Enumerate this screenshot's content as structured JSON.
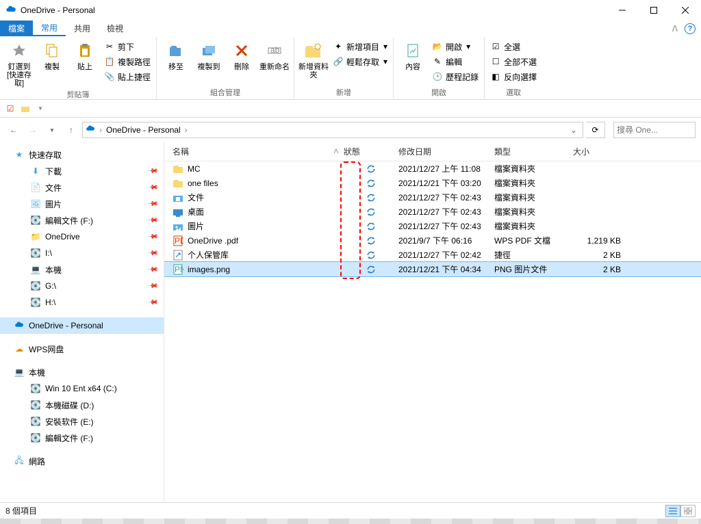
{
  "window": {
    "title": "OneDrive - Personal"
  },
  "tabs": {
    "file": "檔案",
    "home": "常用",
    "share": "共用",
    "view": "檢視"
  },
  "ribbon": {
    "clipboard": {
      "pin_label": "釘選到 [快速存取]",
      "copy": "複製",
      "paste": "貼上",
      "cut": "剪下",
      "copy_path": "複製路徑",
      "paste_shortcut": "貼上捷徑",
      "group": "剪貼簿"
    },
    "organize": {
      "move_to": "移至",
      "copy_to": "複製到",
      "delete": "刪除",
      "rename": "重新命名",
      "group": "組合管理"
    },
    "new": {
      "new_folder": "新增資料夾",
      "new_item": "新增項目",
      "easy_access": "輕鬆存取",
      "group": "新增"
    },
    "open": {
      "properties": "內容",
      "open": "開啟",
      "edit": "編輯",
      "history": "歷程記錄",
      "group": "開啟"
    },
    "select": {
      "select_all": "全選",
      "select_none": "全部不選",
      "invert": "反向選擇",
      "group": "選取"
    }
  },
  "breadcrumb": {
    "location": "OneDrive - Personal"
  },
  "search": {
    "placeholder": "搜尋 One..."
  },
  "columns": {
    "name": "名稱",
    "status": "狀態",
    "modified": "修改日期",
    "type": "類型",
    "size": "大小"
  },
  "rows": [
    {
      "icon": "folder-yellow",
      "name": "MC",
      "date": "2021/12/27 上午 11:08",
      "type": "檔案資料夾",
      "size": ""
    },
    {
      "icon": "folder-yellow",
      "name": "one files",
      "date": "2021/12/21 下午 03:20",
      "type": "檔案資料夾",
      "size": ""
    },
    {
      "icon": "folder-docs",
      "name": "文件",
      "date": "2021/12/27 下午 02:43",
      "type": "檔案資料夾",
      "size": ""
    },
    {
      "icon": "folder-desktop",
      "name": "桌面",
      "date": "2021/12/27 下午 02:43",
      "type": "檔案資料夾",
      "size": ""
    },
    {
      "icon": "folder-pics",
      "name": "圖片",
      "date": "2021/12/27 下午 02:43",
      "type": "檔案資料夾",
      "size": ""
    },
    {
      "icon": "pdf",
      "name": "OneDrive .pdf",
      "date": "2021/9/7 下午 06:16",
      "type": "WPS PDF 文檔",
      "size": "1,219 KB"
    },
    {
      "icon": "link",
      "name": "个人保管库",
      "date": "2021/12/27 下午 02:42",
      "type": "捷徑",
      "size": "2 KB"
    },
    {
      "icon": "png",
      "name": "images.png",
      "date": "2021/12/21 下午 04:34",
      "type": "PNG 图片文件",
      "size": "2 KB",
      "selected": true
    }
  ],
  "nav": {
    "quick_access": "快速存取",
    "downloads": "下載",
    "documents": "文件",
    "pictures": "圖片",
    "edit_files_f": "編輯文件 (F:)",
    "onedrive_folder": "OneDrive",
    "drive_i": "I:\\",
    "this_pc_short": "本機",
    "drive_g": "G:\\",
    "drive_h": "H:\\",
    "onedrive_personal": "OneDrive - Personal",
    "wps_cloud": "WPS网盘",
    "this_pc": "本機",
    "win10": "Win 10 Ent x64 (C:)",
    "local_disk_d": "本機磁碟 (D:)",
    "install_e": "安裝软件 (E:)",
    "edit_files_f2": "編輯文件 (F:)",
    "network": "網路"
  },
  "status": {
    "count": "8 個項目"
  }
}
